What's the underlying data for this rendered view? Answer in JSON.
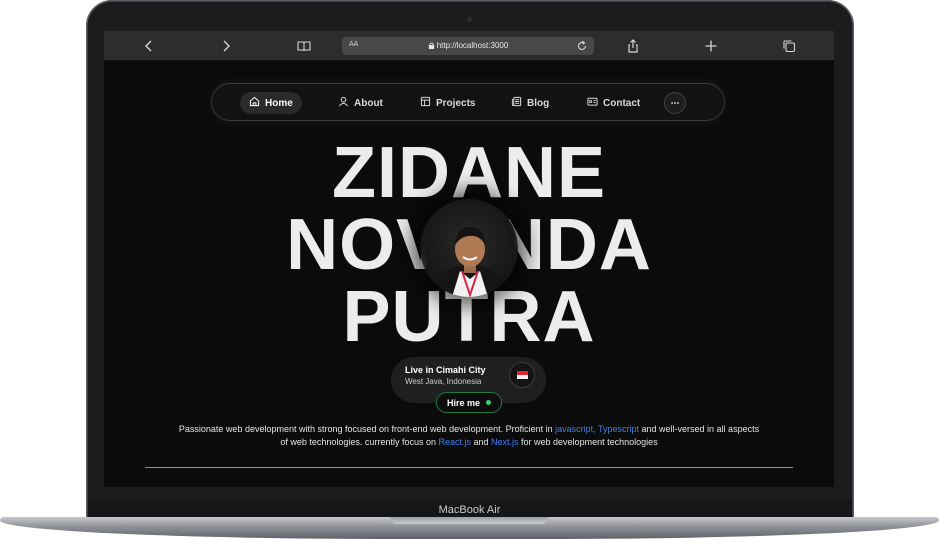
{
  "device": {
    "label": "MacBook Air"
  },
  "browser": {
    "url_prefix": "AA",
    "url": "http://localhost:3000",
    "icons": [
      "chevron-left-icon",
      "chevron-right-icon",
      "book-icon",
      "lock-icon",
      "reload-icon",
      "share-icon",
      "plus-icon",
      "tabs-icon"
    ]
  },
  "nav": {
    "items": [
      {
        "label": "Home",
        "icon": "home-icon",
        "active": true
      },
      {
        "label": "About",
        "icon": "user-icon",
        "active": false
      },
      {
        "label": "Projects",
        "icon": "layout-icon",
        "active": false
      },
      {
        "label": "Blog",
        "icon": "newspaper-icon",
        "active": false
      },
      {
        "label": "Contact",
        "icon": "id-card-icon",
        "active": false
      }
    ],
    "more_icon": "more-dots-icon"
  },
  "hero": {
    "line1": "ZIDANE",
    "line2": "NOVANDA",
    "line3": "PUTRA"
  },
  "location": {
    "title": "Live in Cimahi City",
    "subtitle": "West Java, Indonesia",
    "flag": "indonesia-flag"
  },
  "hire": {
    "label": "Hire me",
    "status_color": "#34d16a"
  },
  "bio": {
    "p1": "Passionate web development with strong focused on front-end web development. Proficient in ",
    "h1": "javascript, Typescript",
    "p2": " and well-versed in all aspects of web technologies. currently focus on ",
    "h2": "React.js",
    "p3": " and ",
    "h3": "Next.js",
    "p4": " for web development technologies"
  },
  "colors": {
    "accent": "#3f7ff0",
    "background": "#0b0b0b",
    "hire_border": "#1e7a3f"
  }
}
